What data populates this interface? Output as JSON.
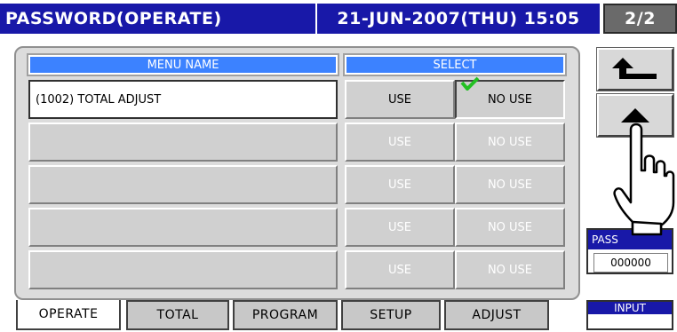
{
  "header": {
    "title": "PASSWORD(OPERATE)",
    "datetime": "21-JUN-2007(THU) 15:05",
    "page": "2/2"
  },
  "table": {
    "col_name": "MENU NAME",
    "col_select": "SELECT",
    "use_label": "USE",
    "nouse_label": "NO USE",
    "rows": [
      {
        "name": "(1002) TOTAL ADJUST",
        "use": "USE",
        "nouse": "NO USE",
        "selected": "NO USE"
      },
      {
        "name": "",
        "use": "USE",
        "nouse": "NO USE"
      },
      {
        "name": "",
        "use": "USE",
        "nouse": "NO USE"
      },
      {
        "name": "",
        "use": "USE",
        "nouse": "NO USE"
      },
      {
        "name": "",
        "use": "USE",
        "nouse": "NO USE"
      }
    ]
  },
  "tabs": [
    {
      "label": "OPERATE",
      "active": true
    },
    {
      "label": "TOTAL"
    },
    {
      "label": "PROGRAM"
    },
    {
      "label": "SETUP"
    },
    {
      "label": "ADJUST"
    }
  ],
  "right": {
    "password_label": "PASS",
    "password_value": "000000",
    "input_label": "INPUT"
  },
  "colors": {
    "titlebar": "#1818a8",
    "header_cell": "#3c82ff",
    "check": "#22c022"
  },
  "icons": {
    "back": "return-arrow-icon",
    "up": "up-triangle-icon",
    "hand": "pointing-hand-icon",
    "check": "checkmark-icon"
  }
}
